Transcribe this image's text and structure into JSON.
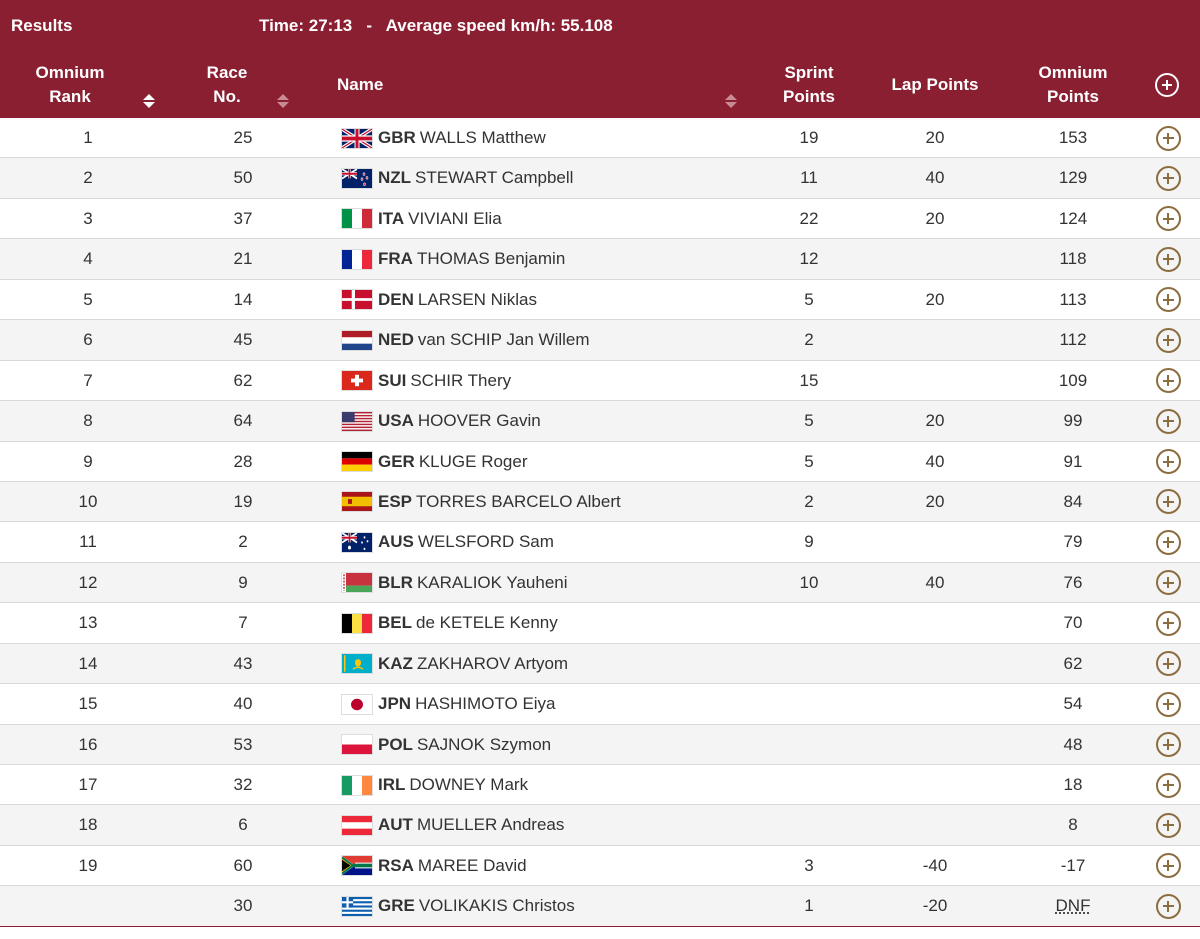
{
  "header": {
    "results_label": "Results",
    "time_info": "Time: 27:13   -   Average speed km/h: 55.108"
  },
  "columns": {
    "rank_l1": "Omnium",
    "rank_l2": "Rank",
    "race_l1": "Race",
    "race_l2": "No.",
    "name": "Name",
    "sprint_l1": "Sprint",
    "sprint_l2": "Points",
    "lap": "Lap Points",
    "omnium_l1": "Omnium",
    "omnium_l2": "Points"
  },
  "rows": [
    {
      "rank": "1",
      "race": "25",
      "flag": "gbr",
      "noc": "GBR",
      "name": "WALLS Matthew",
      "sprint": "19",
      "lap": "20",
      "points": "153"
    },
    {
      "rank": "2",
      "race": "50",
      "flag": "nzl",
      "noc": "NZL",
      "name": "STEWART Campbell",
      "sprint": "11",
      "lap": "40",
      "points": "129"
    },
    {
      "rank": "3",
      "race": "37",
      "flag": "ita",
      "noc": "ITA",
      "name": "VIVIANI Elia",
      "sprint": "22",
      "lap": "20",
      "points": "124"
    },
    {
      "rank": "4",
      "race": "21",
      "flag": "fra",
      "noc": "FRA",
      "name": "THOMAS Benjamin",
      "sprint": "12",
      "lap": "",
      "points": "118"
    },
    {
      "rank": "5",
      "race": "14",
      "flag": "den",
      "noc": "DEN",
      "name": "LARSEN Niklas",
      "sprint": "5",
      "lap": "20",
      "points": "113"
    },
    {
      "rank": "6",
      "race": "45",
      "flag": "ned",
      "noc": "NED",
      "name": "van SCHIP Jan Willem",
      "sprint": "2",
      "lap": "",
      "points": "112"
    },
    {
      "rank": "7",
      "race": "62",
      "flag": "sui",
      "noc": "SUI",
      "name": "SCHIR Thery",
      "sprint": "15",
      "lap": "",
      "points": "109"
    },
    {
      "rank": "8",
      "race": "64",
      "flag": "usa",
      "noc": "USA",
      "name": "HOOVER Gavin",
      "sprint": "5",
      "lap": "20",
      "points": "99"
    },
    {
      "rank": "9",
      "race": "28",
      "flag": "ger",
      "noc": "GER",
      "name": "KLUGE Roger",
      "sprint": "5",
      "lap": "40",
      "points": "91"
    },
    {
      "rank": "10",
      "race": "19",
      "flag": "esp",
      "noc": "ESP",
      "name": "TORRES BARCELO Albert",
      "sprint": "2",
      "lap": "20",
      "points": "84"
    },
    {
      "rank": "11",
      "race": "2",
      "flag": "aus",
      "noc": "AUS",
      "name": "WELSFORD Sam",
      "sprint": "9",
      "lap": "",
      "points": "79"
    },
    {
      "rank": "12",
      "race": "9",
      "flag": "blr",
      "noc": "BLR",
      "name": "KARALIOK Yauheni",
      "sprint": "10",
      "lap": "40",
      "points": "76"
    },
    {
      "rank": "13",
      "race": "7",
      "flag": "bel",
      "noc": "BEL",
      "name": "de KETELE Kenny",
      "sprint": "",
      "lap": "",
      "points": "70"
    },
    {
      "rank": "14",
      "race": "43",
      "flag": "kaz",
      "noc": "KAZ",
      "name": "ZAKHAROV Artyom",
      "sprint": "",
      "lap": "",
      "points": "62"
    },
    {
      "rank": "15",
      "race": "40",
      "flag": "jpn",
      "noc": "JPN",
      "name": "HASHIMOTO Eiya",
      "sprint": "",
      "lap": "",
      "points": "54"
    },
    {
      "rank": "16",
      "race": "53",
      "flag": "pol",
      "noc": "POL",
      "name": "SAJNOK Szymon",
      "sprint": "",
      "lap": "",
      "points": "48"
    },
    {
      "rank": "17",
      "race": "32",
      "flag": "irl",
      "noc": "IRL",
      "name": "DOWNEY Mark",
      "sprint": "",
      "lap": "",
      "points": "18"
    },
    {
      "rank": "18",
      "race": "6",
      "flag": "aut",
      "noc": "AUT",
      "name": "MUELLER Andreas",
      "sprint": "",
      "lap": "",
      "points": "8"
    },
    {
      "rank": "19",
      "race": "60",
      "flag": "rsa",
      "noc": "RSA",
      "name": "MAREE David",
      "sprint": "3",
      "lap": "-40",
      "points": "-17"
    },
    {
      "rank": "",
      "race": "30",
      "flag": "gre",
      "noc": "GRE",
      "name": "VOLIKAKIS Christos",
      "sprint": "1",
      "lap": "-20",
      "points": "DNF"
    }
  ],
  "colors": {
    "header_bg": "#8a1f32",
    "expand_icon": "#8c6d3f"
  }
}
